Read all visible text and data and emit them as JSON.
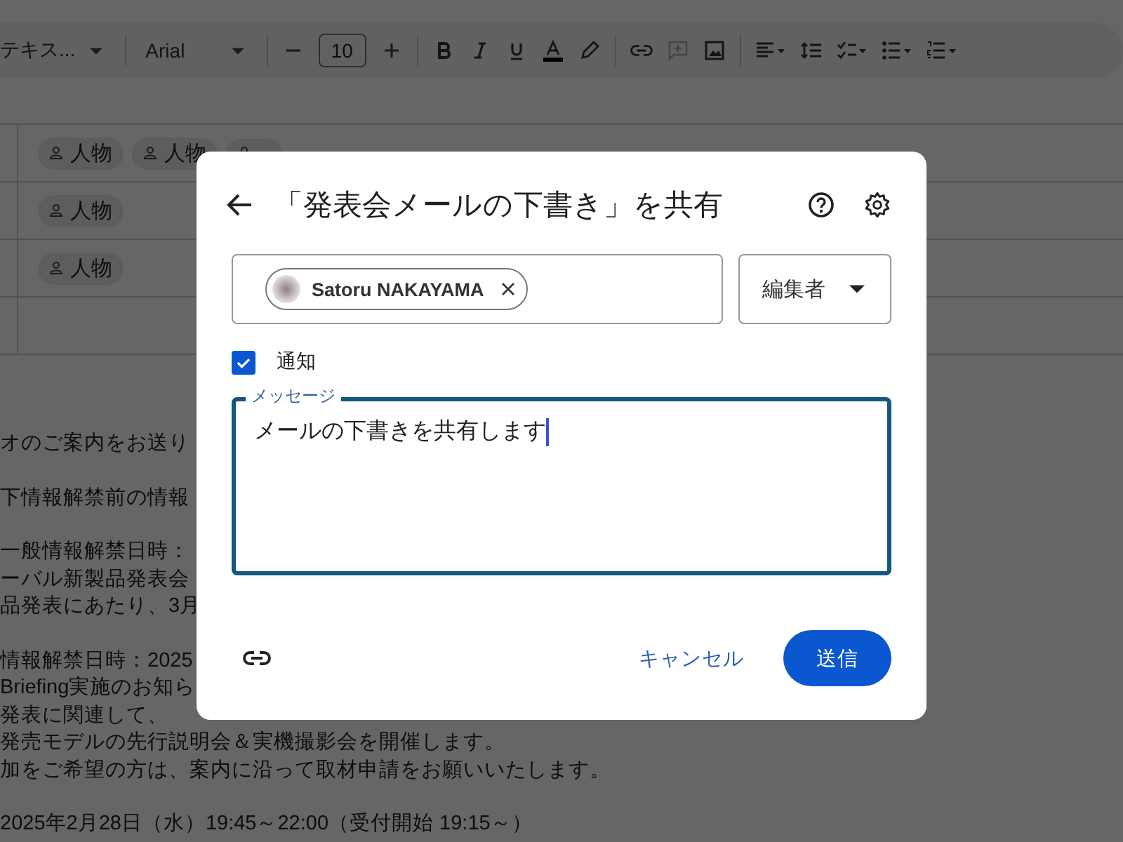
{
  "toolbar": {
    "style": "テキス...",
    "font": "Arial",
    "font_size": "10",
    "comment_disabled": true
  },
  "table": {
    "rows": [
      {
        "chips": [
          "人物",
          "人物"
        ],
        "chip_under_dialog": true
      },
      {
        "chips": [
          "人物"
        ]
      },
      {
        "chips": [
          "人物"
        ]
      },
      {}
    ]
  },
  "document": {
    "paragraphs": [
      [
        "オのご案内をお送り"
      ],
      [
        "下情報解禁前の情報"
      ],
      [
        "一般情報解禁日時：",
        "ーバル新製品発表会",
        "品発表にあたり、3月"
      ],
      [
        "情報解禁日時：2025",
        "Briefing実施のお知ら",
        "発表に関連して、",
        "発売モデルの先行説明会＆実機撮影会を開催します。",
        "加をご希望の方は、案内に沿って取材申請をお願いいたします。"
      ],
      [
        "2025年2月28日（水）19:45～22:00（受付開始  19:15～）"
      ]
    ]
  },
  "dialog": {
    "title": "「発表会メールの下書き」を共有",
    "recipients": [
      {
        "name": "Satoru NAKAYAMA"
      }
    ],
    "role": "編集者",
    "notify": {
      "label": "通知",
      "checked": true
    },
    "message": {
      "label": "メッセージ",
      "value": "メールの下書きを共有します"
    },
    "cancel": "キャンセル",
    "send": "送信"
  }
}
